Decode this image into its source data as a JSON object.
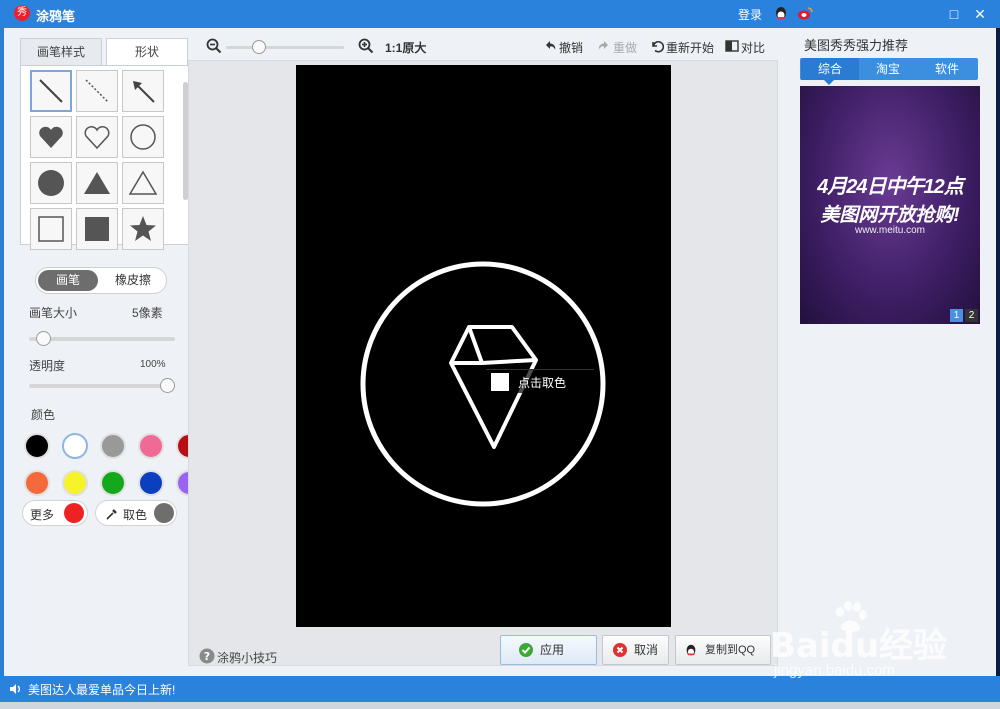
{
  "window": {
    "title": "涂鸦笔",
    "login": "登录",
    "app_icon": "秀"
  },
  "left": {
    "tabs": [
      "画笔样式",
      "形状"
    ],
    "mode": {
      "pen": "画笔",
      "eraser": "橡皮擦"
    },
    "size_label": "画笔大小",
    "size_value": "5像素",
    "size_fraction": 0.05,
    "opacity_label": "透明度",
    "opacity_value": "100%",
    "opacity_fraction": 1.0,
    "color_label": "颜色",
    "colors": [
      "#000000",
      "#ffffff",
      "#999999",
      "#f06a96",
      "#b90f14",
      "#f56a3b",
      "#f7f32b",
      "#14a81d",
      "#0a3fbf",
      "#9b63f2"
    ],
    "more_label": "更多",
    "more_color": "#ee2222",
    "pick_label": "取色",
    "pick_color": "#6e6e6e"
  },
  "toolbar": {
    "zoom_label": "1:1原大",
    "undo": "撤销",
    "redo": "重做",
    "restart": "重新开始",
    "compare": "对比"
  },
  "canvas": {
    "tooltip": "点击取色"
  },
  "footer": {
    "tips": "涂鸦小技巧",
    "apply": "应用",
    "cancel": "取消",
    "copy_qq": "复制到QQ"
  },
  "right": {
    "title": "美图秀秀强力推荐",
    "tabs": [
      "综合",
      "淘宝",
      "软件"
    ],
    "banner_line1": "4月24日中午12点",
    "banner_line2": "美图网开放抢购!",
    "banner_url": "www.meitu.com",
    "pages": [
      "1",
      "2"
    ]
  },
  "status": {
    "text": "美图达人最爱单品今日上新!"
  },
  "watermark": {
    "brand": "Baidu经验",
    "url": "jingyan.baidu.com"
  }
}
